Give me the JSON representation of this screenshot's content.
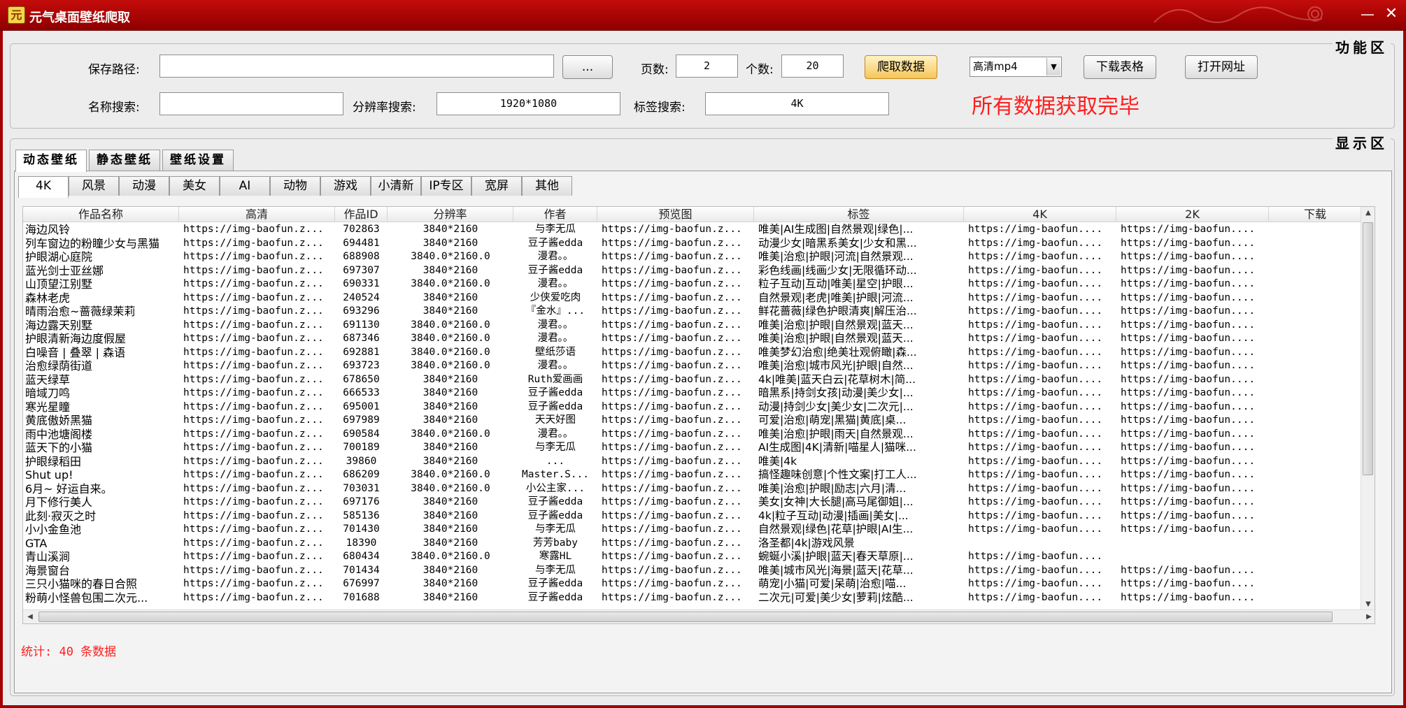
{
  "window": {
    "title": "元气桌面壁纸爬取",
    "icon_glyph": "元",
    "minimize": "—",
    "close": "✕"
  },
  "func_group": {
    "title": "功能区",
    "save_path_label": "保存路径:",
    "save_path_value": "",
    "browse_label": "...",
    "pages_label": "页数:",
    "pages_value": "2",
    "count_label": "个数:",
    "count_value": "20",
    "crawl_button": "爬取数据",
    "quality_select": "高清mp4",
    "download_table_button": "下载表格",
    "open_url_button": "打开网址",
    "name_search_label": "名称搜索:",
    "name_search_value": "",
    "resolution_search_label": "分辨率搜索:",
    "resolution_search_value": "1920*1080",
    "tag_search_label": "标签搜索:",
    "tag_search_value": "4K",
    "status_message": "所有数据获取完毕"
  },
  "display_group": {
    "title": "显示区",
    "main_tabs": [
      "动态壁纸",
      "静态壁纸",
      "壁纸设置"
    ],
    "sub_tabs": [
      "4K",
      "风景",
      "动漫",
      "美女",
      "AI",
      "动物",
      "游戏",
      "小清新",
      "IP专区",
      "宽屏",
      "其他"
    ],
    "columns": [
      "作品名称",
      "高清",
      "作品ID",
      "分辨率",
      "作者",
      "预览图",
      "标签",
      "4K",
      "2K",
      "下载"
    ],
    "rows": [
      [
        "海边风铃",
        "https://img-baofun.z...",
        "702863",
        "3840*2160",
        "与李无瓜",
        "https://img-baofun.z...",
        "唯美|AI生成图|自然景观|绿色|...",
        "https://img-baofun....",
        "https://img-baofun....",
        ""
      ],
      [
        "列车窗边的粉瞳少女与黑猫",
        "https://img-baofun.z...",
        "694481",
        "3840*2160",
        "豆子酱edda",
        "https://img-baofun.z...",
        "动漫少女|暗黑系美女|少女和黑...",
        "https://img-baofun....",
        "https://img-baofun....",
        ""
      ],
      [
        "护眼湖心庭院",
        "https://img-baofun.z...",
        "688908",
        "3840.0*2160.0",
        "漫君。。",
        "https://img-baofun.z...",
        "唯美|治愈|护眼|河流|自然景观...",
        "https://img-baofun....",
        "https://img-baofun....",
        ""
      ],
      [
        "蓝光剑士亚丝娜",
        "https://img-baofun.z...",
        "697307",
        "3840*2160",
        "豆子酱edda",
        "https://img-baofun.z...",
        "彩色线画|线画少女|无限循环动...",
        "https://img-baofun....",
        "https://img-baofun....",
        ""
      ],
      [
        "山顶望江别墅",
        "https://img-baofun.z...",
        "690331",
        "3840.0*2160.0",
        "漫君。。",
        "https://img-baofun.z...",
        "粒子互动|互动|唯美|星空|护眼...",
        "https://img-baofun....",
        "https://img-baofun....",
        ""
      ],
      [
        "森林老虎",
        "https://img-baofun.z...",
        "240524",
        "3840*2160",
        "少侠爱吃肉",
        "https://img-baofun.z...",
        "自然景观|老虎|唯美|护眼|河流...",
        "https://img-baofun....",
        "https://img-baofun....",
        ""
      ],
      [
        "晴雨治愈~蔷薇绿茉莉",
        "https://img-baofun.z...",
        "693296",
        "3840*2160",
        "『金水』...",
        "https://img-baofun.z...",
        "鲜花蔷薇|绿色护眼清爽|解压治...",
        "https://img-baofun....",
        "https://img-baofun....",
        ""
      ],
      [
        "海边露天别墅",
        "https://img-baofun.z...",
        "691130",
        "3840.0*2160.0",
        "漫君。。",
        "https://img-baofun.z...",
        "唯美|治愈|护眼|自然景观|蓝天...",
        "https://img-baofun....",
        "https://img-baofun....",
        ""
      ],
      [
        "护眼清新海边度假屋",
        "https://img-baofun.z...",
        "687346",
        "3840.0*2160.0",
        "漫君。。",
        "https://img-baofun.z...",
        "唯美|治愈|护眼|自然景观|蓝天...",
        "https://img-baofun....",
        "https://img-baofun....",
        ""
      ],
      [
        "白噪音 | 叠翠 | 森语",
        "https://img-baofun.z...",
        "692881",
        "3840.0*2160.0",
        "壁纸莎语",
        "https://img-baofun.z...",
        "唯美梦幻治愈|绝美壮观俯瞰|森...",
        "https://img-baofun....",
        "https://img-baofun....",
        ""
      ],
      [
        "治愈绿荫街道",
        "https://img-baofun.z...",
        "693723",
        "3840.0*2160.0",
        "漫君。。",
        "https://img-baofun.z...",
        "唯美|治愈|城市风光|护眼|自然...",
        "https://img-baofun....",
        "https://img-baofun....",
        ""
      ],
      [
        "蓝天绿草",
        "https://img-baofun.z...",
        "678650",
        "3840*2160",
        "Ruth爱画画",
        "https://img-baofun.z...",
        "4k|唯美|蓝天白云|花草树木|简...",
        "https://img-baofun....",
        "https://img-baofun....",
        ""
      ],
      [
        "暗域刀鸣",
        "https://img-baofun.z...",
        "666533",
        "3840*2160",
        "豆子酱edda",
        "https://img-baofun.z...",
        "暗黑系|持剑女孩|动漫|美少女|...",
        "https://img-baofun....",
        "https://img-baofun....",
        ""
      ],
      [
        "寒光星瞳",
        "https://img-baofun.z...",
        "695001",
        "3840*2160",
        "豆子酱edda",
        "https://img-baofun.z...",
        "动漫|持剑少女|美少女|二次元|...",
        "https://img-baofun....",
        "https://img-baofun....",
        ""
      ],
      [
        "黄底傲娇黑猫",
        "https://img-baofun.z...",
        "697989",
        "3840*2160",
        "天天好图",
        "https://img-baofun.z...",
        "可爱|治愈|萌宠|黑猫|黄底|桌...",
        "https://img-baofun....",
        "https://img-baofun....",
        ""
      ],
      [
        "雨中池塘阁楼",
        "https://img-baofun.z...",
        "690584",
        "3840.0*2160.0",
        "漫君。。",
        "https://img-baofun.z...",
        "唯美|治愈|护眼|雨天|自然景观...",
        "https://img-baofun....",
        "https://img-baofun....",
        ""
      ],
      [
        "蓝天下的小猫",
        "https://img-baofun.z...",
        "700189",
        "3840*2160",
        "与李无瓜",
        "https://img-baofun.z...",
        "AI生成图|4K|清新|喵星人|猫咪...",
        "https://img-baofun....",
        "https://img-baofun....",
        ""
      ],
      [
        "护眼绿稻田",
        "https://img-baofun.z...",
        "39860",
        "3840*2160",
        "...",
        "https://img-baofun.z...",
        "唯美|4k",
        "https://img-baofun....",
        "https://img-baofun....",
        ""
      ],
      [
        "Shut up!",
        "https://img-baofun.z...",
        "686209",
        "3840.0*2160.0",
        "Master.S...",
        "https://img-baofun.z...",
        "搞怪趣味创意|个性文案|打工人...",
        "https://img-baofun....",
        "https://img-baofun....",
        ""
      ],
      [
        "6月~ 好运自来。",
        "https://img-baofun.z...",
        "703031",
        "3840.0*2160.0",
        "小公主家...",
        "https://img-baofun.z...",
        "唯美|治愈|护眼|励志|六月|清...",
        "https://img-baofun....",
        "https://img-baofun....",
        ""
      ],
      [
        "月下修行美人",
        "https://img-baofun.z...",
        "697176",
        "3840*2160",
        "豆子酱edda",
        "https://img-baofun.z...",
        "美女|女神|大长腿|高马尾御姐|...",
        "https://img-baofun....",
        "https://img-baofun....",
        ""
      ],
      [
        "此刻·寂灭之时",
        "https://img-baofun.z...",
        "585136",
        "3840*2160",
        "豆子酱edda",
        "https://img-baofun.z...",
        "4k|粒子互动|动漫|插画|美女|...",
        "https://img-baofun....",
        "https://img-baofun....",
        ""
      ],
      [
        "小小金鱼池",
        "https://img-baofun.z...",
        "701430",
        "3840*2160",
        "与李无瓜",
        "https://img-baofun.z...",
        "自然景观|绿色|花草|护眼|AI生...",
        "https://img-baofun....",
        "https://img-baofun....",
        ""
      ],
      [
        "GTA",
        "https://img-baofun.z...",
        "18390",
        "3840*2160",
        "芳芳baby",
        "https://img-baofun.z...",
        "洛圣都|4k|游戏风景",
        "",
        "",
        ""
      ],
      [
        "青山溪涧",
        "https://img-baofun.z...",
        "680434",
        "3840.0*2160.0",
        "寒露HL",
        "https://img-baofun.z...",
        "蜿蜒小溪|护眼|蓝天|春天草原|...",
        "https://img-baofun....",
        "",
        ""
      ],
      [
        "海景窗台",
        "https://img-baofun.z...",
        "701434",
        "3840*2160",
        "与李无瓜",
        "https://img-baofun.z...",
        "唯美|城市风光|海景|蓝天|花草...",
        "https://img-baofun....",
        "https://img-baofun....",
        ""
      ],
      [
        "三只小猫咪的春日合照",
        "https://img-baofun.z...",
        "676997",
        "3840*2160",
        "豆子酱edda",
        "https://img-baofun.z...",
        "萌宠|小猫|可爱|呆萌|治愈|喵...",
        "https://img-baofun....",
        "https://img-baofun....",
        ""
      ],
      [
        "粉萌小怪兽包围二次元...",
        "https://img-baofun.z...",
        "701688",
        "3840*2160",
        "豆子酱edda",
        "https://img-baofun.z...",
        "二次元|可爱|美少女|萝莉|炫酷...",
        "https://img-baofun....",
        "https://img-baofun....",
        ""
      ]
    ],
    "scroll_up": "▲",
    "scroll_down": "▼",
    "scroll_left": "◀",
    "scroll_right": "▶",
    "stats_text": "统计: 40 条数据"
  },
  "colors": {
    "titlebar": "#b00808",
    "status_red": "#ff1e1e",
    "crawl_button": "#f7c65a"
  }
}
